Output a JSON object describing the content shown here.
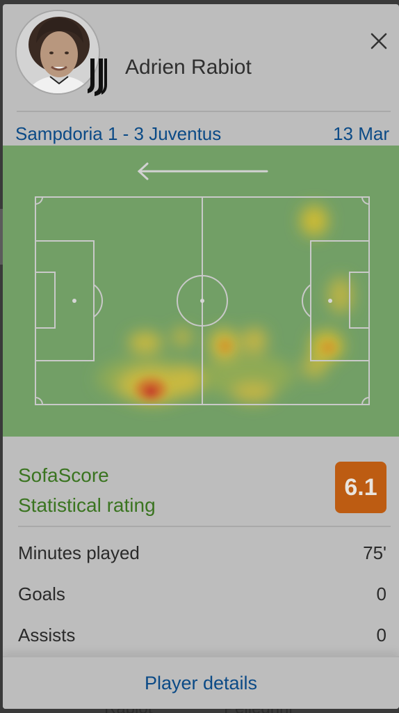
{
  "background": {
    "partial_labels": [
      "Rabiot",
      "Pellegrini"
    ]
  },
  "player": {
    "name": "Adrien Rabiot"
  },
  "match": {
    "title": "Sampdoria 1 - 3 Juventus",
    "date": "13 Mar"
  },
  "heatmap": {
    "direction": "left",
    "pitch_color": "#729f66"
  },
  "rating": {
    "label_line1": "SofaScore",
    "label_line2": "Statistical rating",
    "value": "6.1",
    "badge_color": "#bd5c12"
  },
  "stats": [
    {
      "label": "Minutes played",
      "value": "75'"
    },
    {
      "label": "Goals",
      "value": "0"
    },
    {
      "label": "Assists",
      "value": "0"
    }
  ],
  "footer": {
    "link_label": "Player details"
  }
}
